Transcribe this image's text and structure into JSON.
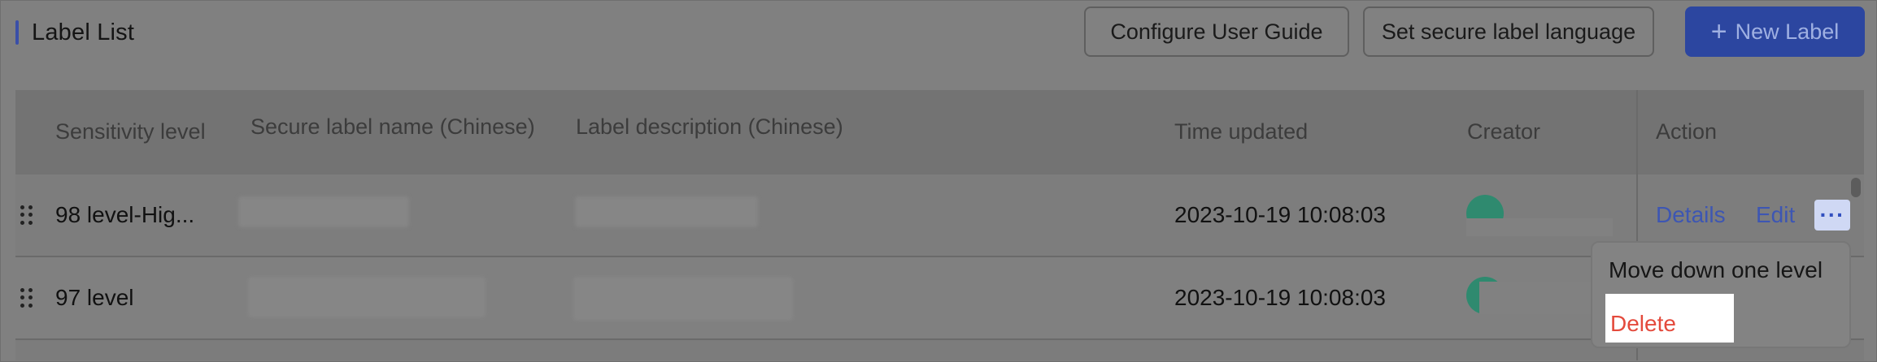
{
  "header": {
    "title": "Label List",
    "buttons": {
      "configure_guide": "Configure User Guide",
      "set_language": "Set secure label language",
      "new_label": "New Label",
      "new_label_icon": "+"
    }
  },
  "table": {
    "columns": {
      "sensitivity": "Sensitivity level",
      "name": "Secure label name (Chinese)",
      "description": "Label description (Chinese)",
      "time_updated": "Time updated",
      "creator": "Creator",
      "action": "Action"
    },
    "rows": [
      {
        "sensitivity": "98 level-Hig...",
        "time_updated": "2023-10-19 10:08:03"
      },
      {
        "sensitivity": "97 level",
        "time_updated": "2023-10-19 10:08:03"
      }
    ],
    "actions": {
      "details": "Details",
      "edit": "Edit",
      "more": "···"
    }
  },
  "dropdown": {
    "items": [
      "Move down one level",
      "Delete"
    ]
  },
  "colors": {
    "primary": "#2c46a0",
    "link": "#3d56b3",
    "danger": "#e44a3c",
    "avatar": "#2f8a6f"
  }
}
